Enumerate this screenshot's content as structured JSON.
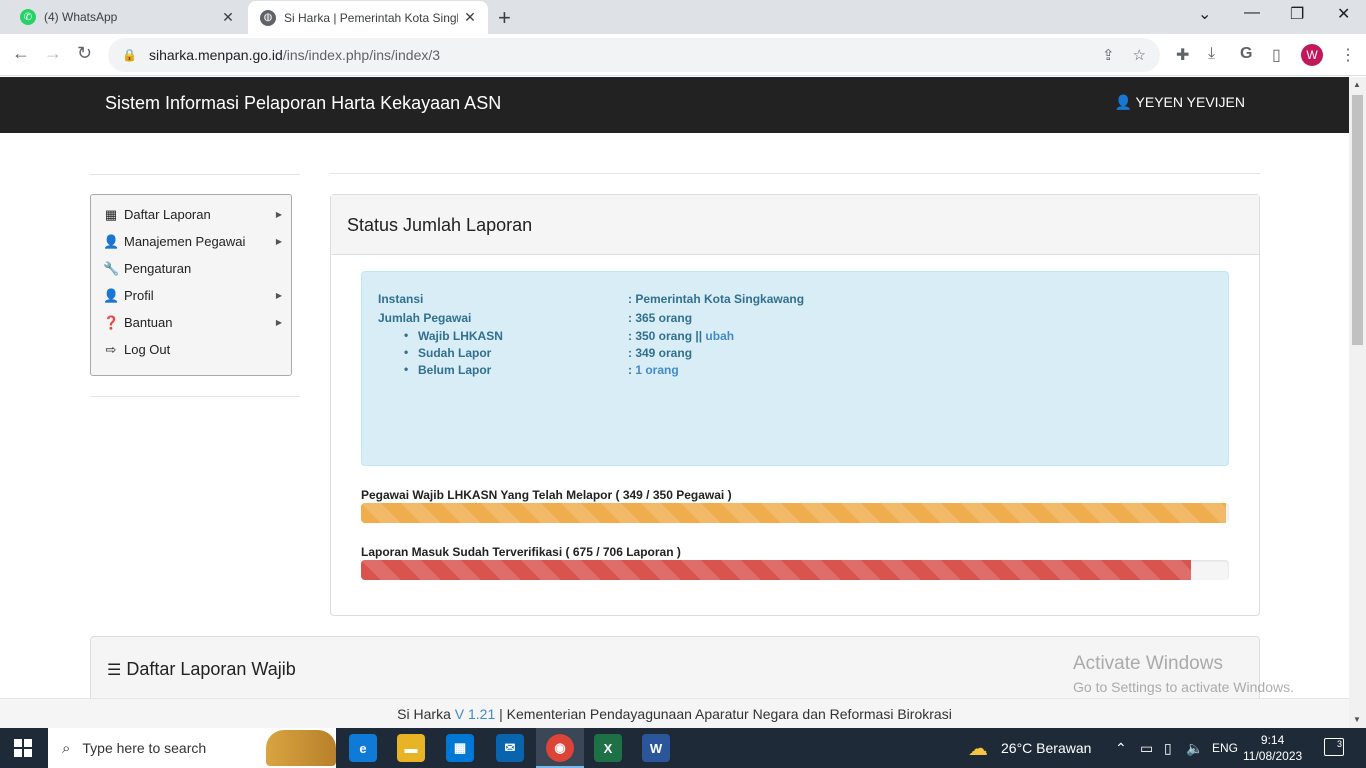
{
  "browser": {
    "tabs": [
      {
        "label": "(4) WhatsApp",
        "active": false
      },
      {
        "label": "Si Harka | Pemerintah Kota Singk",
        "active": true
      }
    ],
    "url_host": "siharka.menpan.go.id",
    "url_path": "/ins/index.php/ins/index/3",
    "profile_initial": "W"
  },
  "navbar": {
    "brand": "Sistem Informasi Pelaporan Harta Kekayaan ASN",
    "user": "YEYEN YEVIJEN"
  },
  "sidebar": {
    "items": [
      {
        "label": "Daftar Laporan",
        "icon": "table-icon",
        "submenu": true
      },
      {
        "label": "Manajemen Pegawai",
        "icon": "user-icon",
        "submenu": true
      },
      {
        "label": "Pengaturan",
        "icon": "wrench-icon",
        "submenu": false
      },
      {
        "label": "Profil",
        "icon": "user-icon",
        "submenu": true
      },
      {
        "label": "Bantuan",
        "icon": "question-icon",
        "submenu": true
      },
      {
        "label": "Log Out",
        "icon": "logout-icon",
        "submenu": false
      }
    ]
  },
  "status": {
    "title": "Status Jumlah Laporan",
    "instansi_label": "Instansi",
    "instansi_value": ": Pemerintah Kota Singkawang",
    "jumlah_label": "Jumlah Pegawai",
    "jumlah_value": ": 365 orang",
    "wajib_label": "Wajib LHKASN",
    "wajib_value": ": 350 orang ||",
    "ubah_link": "ubah",
    "sudah_label": "Sudah Lapor",
    "sudah_value": ": 349 orang",
    "belum_label": "Belum Lapor",
    "belum_value_prefix": ":",
    "belum_value": "1 orang"
  },
  "progress": {
    "melapor_label": "Pegawai Wajib LHKASN Yang Telah Melapor ( 349 / 350 Pegawai )",
    "melapor_fraction": 0.9971,
    "verifikasi_label": "Laporan Masuk Sudah Terverifikasi ( 675 / 706 Laporan )",
    "verifikasi_fraction": 0.9561
  },
  "daftar": {
    "title": "Daftar Laporan Wajib"
  },
  "watermark": {
    "line1": "Activate Windows",
    "line2": "Go to Settings to activate Windows."
  },
  "footer": {
    "app": "Si Harka",
    "version": "V 1.21",
    "org": "| Kementerian Pendayagunaan Aparatur Negara dan Reformasi Birokrasi"
  },
  "taskbar": {
    "search_placeholder": "Type here to search",
    "weather": "26°C  Berawan",
    "lang": "ENG",
    "time": "9:14",
    "date": "11/08/2023",
    "notifications": "3"
  },
  "colors": {
    "navbar": "#222222",
    "warning_bar": "#f0ad4e",
    "danger_bar": "#d9534f",
    "info_bg": "#d9edf7"
  }
}
